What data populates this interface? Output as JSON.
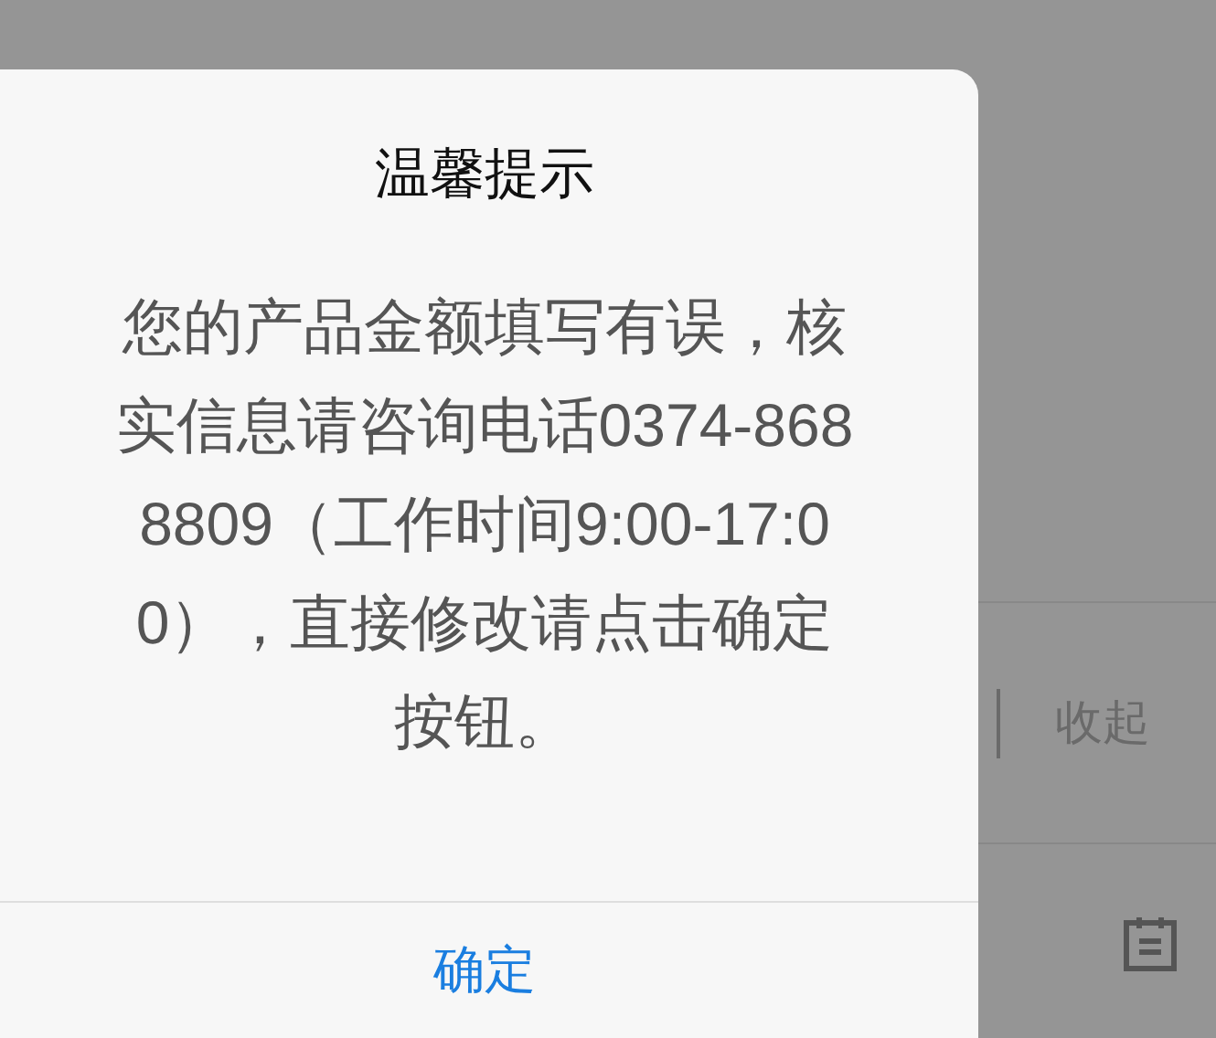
{
  "background": {
    "collapse_link": "收起"
  },
  "dialog": {
    "title": "温馨提示",
    "message": "您的产品金额填写有误，核实信息请咨询电话0374-8688809（工作时间9:00-17:00），直接修改请点击确定按钮。",
    "confirm_button": "确定"
  }
}
